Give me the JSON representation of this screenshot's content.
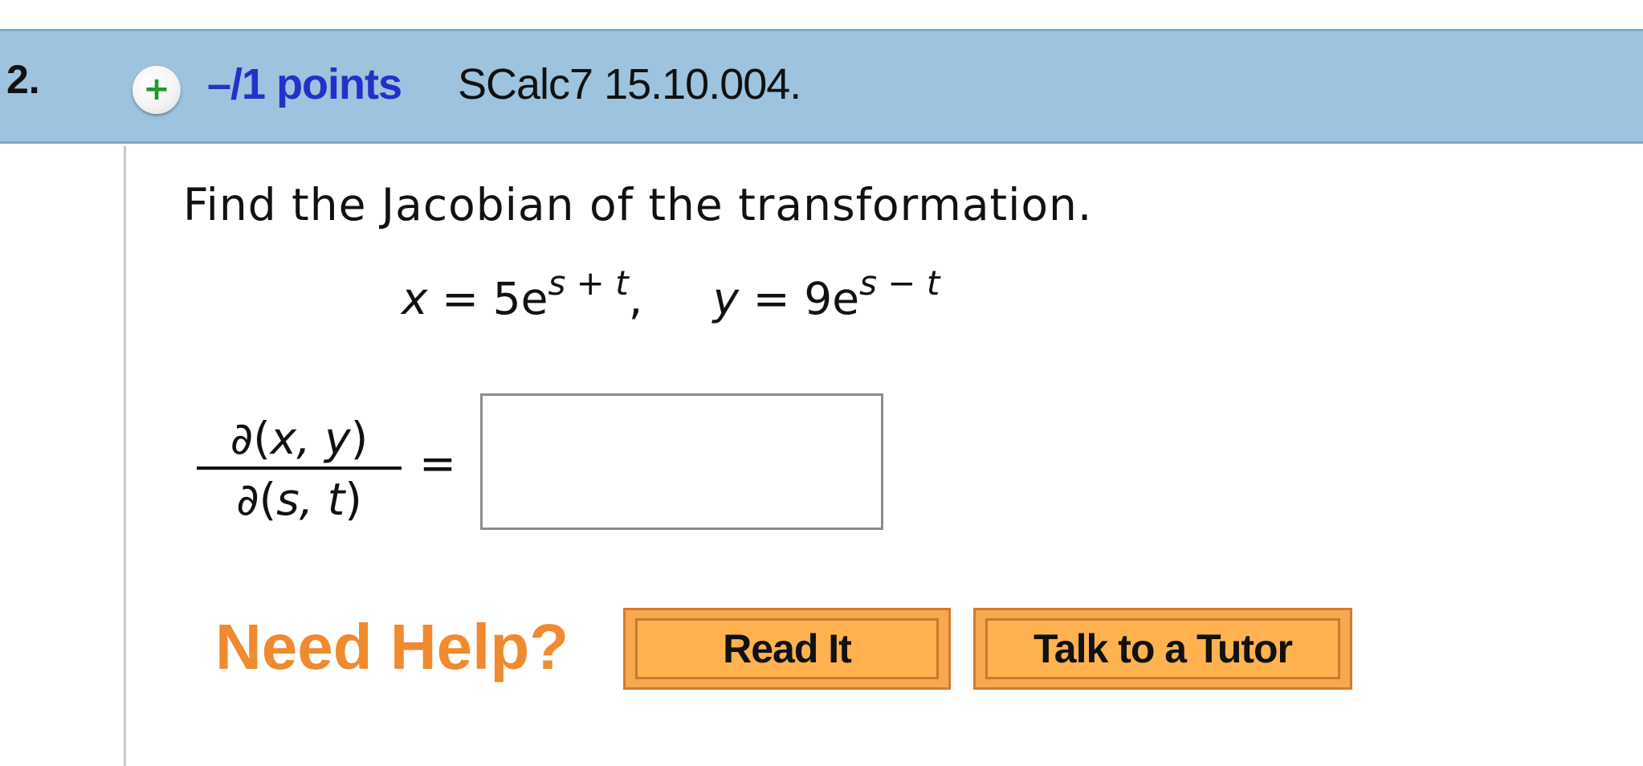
{
  "question": {
    "number": "2.",
    "points": "–/1 points",
    "reference": "SCalc7 15.10.004."
  },
  "icons": {
    "expand": "plus-circle-icon"
  },
  "body": {
    "prompt": "Find the Jacobian of the transformation.",
    "equation": {
      "x_var": "x",
      "x_mid": " = 5e",
      "x_exp": "s + t",
      "sep": ",     ",
      "y_var": "y",
      "y_mid": " = 9e",
      "y_exp": "s − t"
    },
    "fraction": {
      "num_d": "∂(",
      "num_vars": "x, y",
      "num_close": ")",
      "den_d": "∂(",
      "den_vars": "s, t",
      "den_close": ")"
    },
    "equals": "=",
    "answer_value": ""
  },
  "help": {
    "label": "Need Help?",
    "read_it": "Read It",
    "talk_to_tutor": "Talk to a Tutor"
  },
  "colors": {
    "header_bg": "#9dc3de",
    "points_text": "#2430c8",
    "help_text": "#f08a2e",
    "button_bg": "#ffb24f"
  }
}
